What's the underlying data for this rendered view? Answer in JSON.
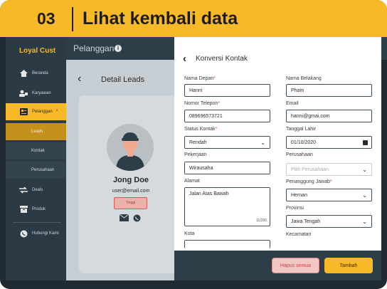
{
  "banner": {
    "step": "03",
    "title": "Lihat kembali data"
  },
  "sidebar": {
    "logo": "Loyal Cust",
    "items": [
      {
        "label": "Beranda",
        "icon": "home-icon"
      },
      {
        "label": "Karyawan",
        "icon": "employees-icon"
      },
      {
        "label": "Pelanggan",
        "icon": "customers-icon",
        "active": true
      },
      {
        "label": "Deals",
        "icon": "deals-icon"
      },
      {
        "label": "Produk",
        "icon": "product-icon"
      },
      {
        "label": "Hubungi Kami",
        "icon": "whatsapp-icon"
      }
    ],
    "subitems": [
      {
        "label": "Leads",
        "active": true
      },
      {
        "label": "Kontak"
      },
      {
        "label": "Perusahaan"
      }
    ]
  },
  "topbar": {
    "title": "Pelanggan",
    "info_glyph": "i"
  },
  "detail": {
    "title": "Detail Leads",
    "name": "Jong Doe",
    "email": "user@email.com",
    "badge": "Tinggi"
  },
  "form": {
    "title": "Konversi Kontak",
    "fields": {
      "first_name": {
        "label": "Nama Depan",
        "value": "Hanni"
      },
      "last_name": {
        "label": "Nama Belakang",
        "value": "Pham"
      },
      "phone": {
        "label": "Nomor Telepon",
        "value": "089696573721"
      },
      "email": {
        "label": "Email",
        "value": "hanni@gmai.com"
      },
      "status": {
        "label": "Status Kontak",
        "value": "Rendah"
      },
      "birthdate": {
        "label": "Tanggal Lahir",
        "value": "01/10/2020"
      },
      "job": {
        "label": "Pekerjaan",
        "value": "Wirausaha"
      },
      "company": {
        "label": "Perusahaan",
        "placeholder": "Pilih Perusahaan"
      },
      "address": {
        "label": "Alamat",
        "value": "Jalan Atas Bawah",
        "counter": "11/200"
      },
      "pic": {
        "label": "Penanggung Jawab",
        "value": "Hernan"
      },
      "province": {
        "label": "Provinsi",
        "value": "Jawa Tengah"
      },
      "city": {
        "label": "Kota"
      },
      "district": {
        "label": "Kecamatan"
      }
    }
  },
  "footer": {
    "clear_label": "Hapus semua",
    "add_label": "Tambah"
  },
  "colors": {
    "accent": "#f7b928",
    "dark": "#2d3e49",
    "danger": "#d55a5a"
  }
}
